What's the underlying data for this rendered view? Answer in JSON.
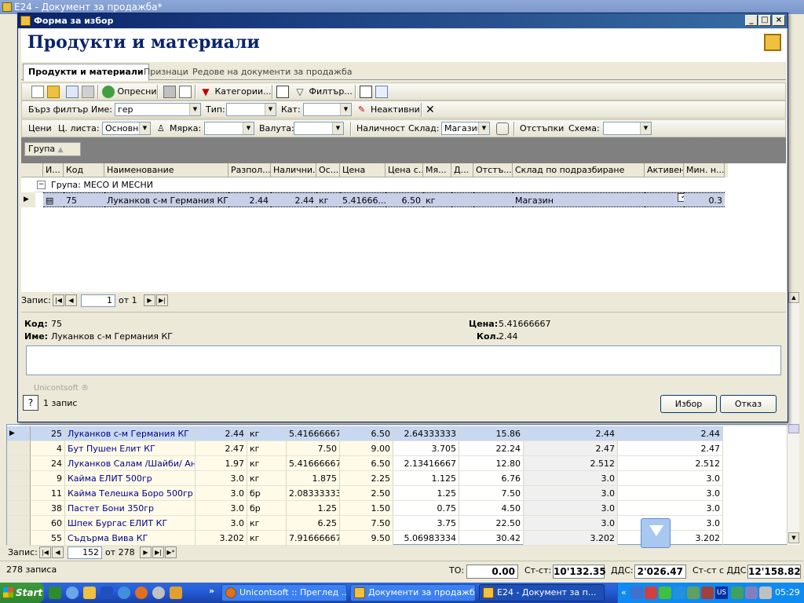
{
  "background": {
    "title": "E24 - Документ за продажба*",
    "grid_rows": [
      {
        "c0": "25",
        "c1": "Луканков с-м Германия КГ",
        "c2": "2.44",
        "c3": "кг",
        "c4": "5.41666667",
        "c5": "6.50",
        "c6": "2.64333333",
        "c7": "15.86",
        "c8": "2.44",
        "c9": "2.44",
        "selected": true
      },
      {
        "c0": "4",
        "c1": "Бут Пушен Елит КГ",
        "c2": "2.47",
        "c3": "кг",
        "c4": "7.50",
        "c5": "9.00",
        "c6": "3.705",
        "c7": "22.24",
        "c8": "2.47",
        "c9": "2.47"
      },
      {
        "c0": "24",
        "c1": "Луканков Салам /Шайби/ Ано...",
        "c2": "1.97",
        "c3": "кг",
        "c4": "5.41666667",
        "c5": "6.50",
        "c6": "2.13416667",
        "c7": "12.80",
        "c8": "2.512",
        "c9": "2.512"
      },
      {
        "c0": "9",
        "c1": "Кайма ЕЛИТ 500гр",
        "c2": "3.0",
        "c3": "кг",
        "c4": "1.875",
        "c5": "2.25",
        "c6": "1.125",
        "c7": "6.76",
        "c8": "3.0",
        "c9": "3.0"
      },
      {
        "c0": "11",
        "c1": "Кайма Телешка Боро 500гр",
        "c2": "3.0",
        "c3": "бр",
        "c4": "2.08333333",
        "c5": "2.50",
        "c6": "1.25",
        "c7": "7.50",
        "c8": "3.0",
        "c9": "3.0"
      },
      {
        "c0": "38",
        "c1": "Пастет Бони 350гр",
        "c2": "3.0",
        "c3": "бр",
        "c4": "1.25",
        "c5": "1.50",
        "c6": "0.75",
        "c7": "4.50",
        "c8": "3.0",
        "c9": "3.0"
      },
      {
        "c0": "60",
        "c1": "Шпек Бургас ЕЛИТ КГ",
        "c2": "3.0",
        "c3": "кг",
        "c4": "6.25",
        "c5": "7.50",
        "c6": "3.75",
        "c7": "22.50",
        "c8": "3.0",
        "c9": "3.0"
      },
      {
        "c0": "55",
        "c1": "Съдърма Вива КГ",
        "c2": "3.202",
        "c3": "кг",
        "c4": "7.91666667",
        "c5": "9.50",
        "c6": "5.06983334",
        "c7": "30.42",
        "c8": "3.202",
        "c9": "3.202"
      }
    ],
    "nav": {
      "label": "Запис:",
      "current": "152",
      "of": "от 278"
    },
    "status": {
      "count": "278 записа",
      "to_label": "ТО:",
      "to": "0.00",
      "st_label": "Ст-ст:",
      "st": "10'132.35",
      "vat_label": "ДДС:",
      "vat": "2'026.47",
      "total_label": "Ст-ст с ДДС:",
      "total": "12'158.82"
    }
  },
  "dialog": {
    "title": "Форма за избор",
    "header": "Продукти и материали",
    "tabs": [
      "Продукти и материали",
      "Признаци",
      "Редове на документи за продажба"
    ],
    "toolbar1": {
      "refresh": "Опресни",
      "categories": "Категории...",
      "filter": "Филтър..."
    },
    "toolbar2": {
      "quick_filter": "Бърз филтър",
      "name_label": "Име:",
      "name_value": "гер",
      "type_label": "Тип:",
      "cat_label": "Кат:",
      "inactive": "Неактивни"
    },
    "toolbar3": {
      "prices": "Цени",
      "pricelist_label": "Ц. листа:",
      "pricelist_value": "Основна",
      "measure_label": "Мярка:",
      "currency_label": "Валута:",
      "availability": "Наличност",
      "store_label": "Склад:",
      "store_value": "Магазин",
      "discounts": "Отстъпки",
      "scheme_label": "Схема:"
    },
    "group_button": "Група",
    "columns": [
      "И...",
      "Код",
      "Наименование",
      "Разпол...",
      "Налични...",
      "Ос...",
      "Цена",
      "Цена с...",
      "Мя...",
      "Д...",
      "Отстъ...",
      "Склад по подразбиране",
      "Активен",
      "Мин. н..."
    ],
    "group_row": "Група: МЕСО И МЕСНИ",
    "row": {
      "code": "75",
      "name": "Луканков с-м Германия КГ",
      "available": "2.44",
      "qty": "2.44",
      "unit": "кг",
      "price": "5.41666...",
      "price_vat": "6.50",
      "unit2": "кг",
      "store": "Магазин",
      "min": "0.3"
    },
    "nav": {
      "label": "Запис:",
      "current": "1",
      "of": "от 1"
    },
    "detail": {
      "code_label": "Код:",
      "code": "75",
      "name_label": "Име:",
      "name": "Луканков с-м Германия КГ",
      "price_label": "Цена:",
      "price": "5.41666667",
      "qty_label": "Кол.",
      "qty": "2.44"
    },
    "brand": "Unicontsoft ®",
    "record_count": "1 запис",
    "select_btn": "Избор",
    "cancel_btn": "Отказ"
  },
  "taskbar": {
    "start": "Start",
    "tasks": [
      "Unicontsoft :: Преглед ...",
      "Документи за продажб...",
      "E24 - Документ за п..."
    ],
    "chevron": "»",
    "clock": "05:29",
    "lang": "US"
  }
}
